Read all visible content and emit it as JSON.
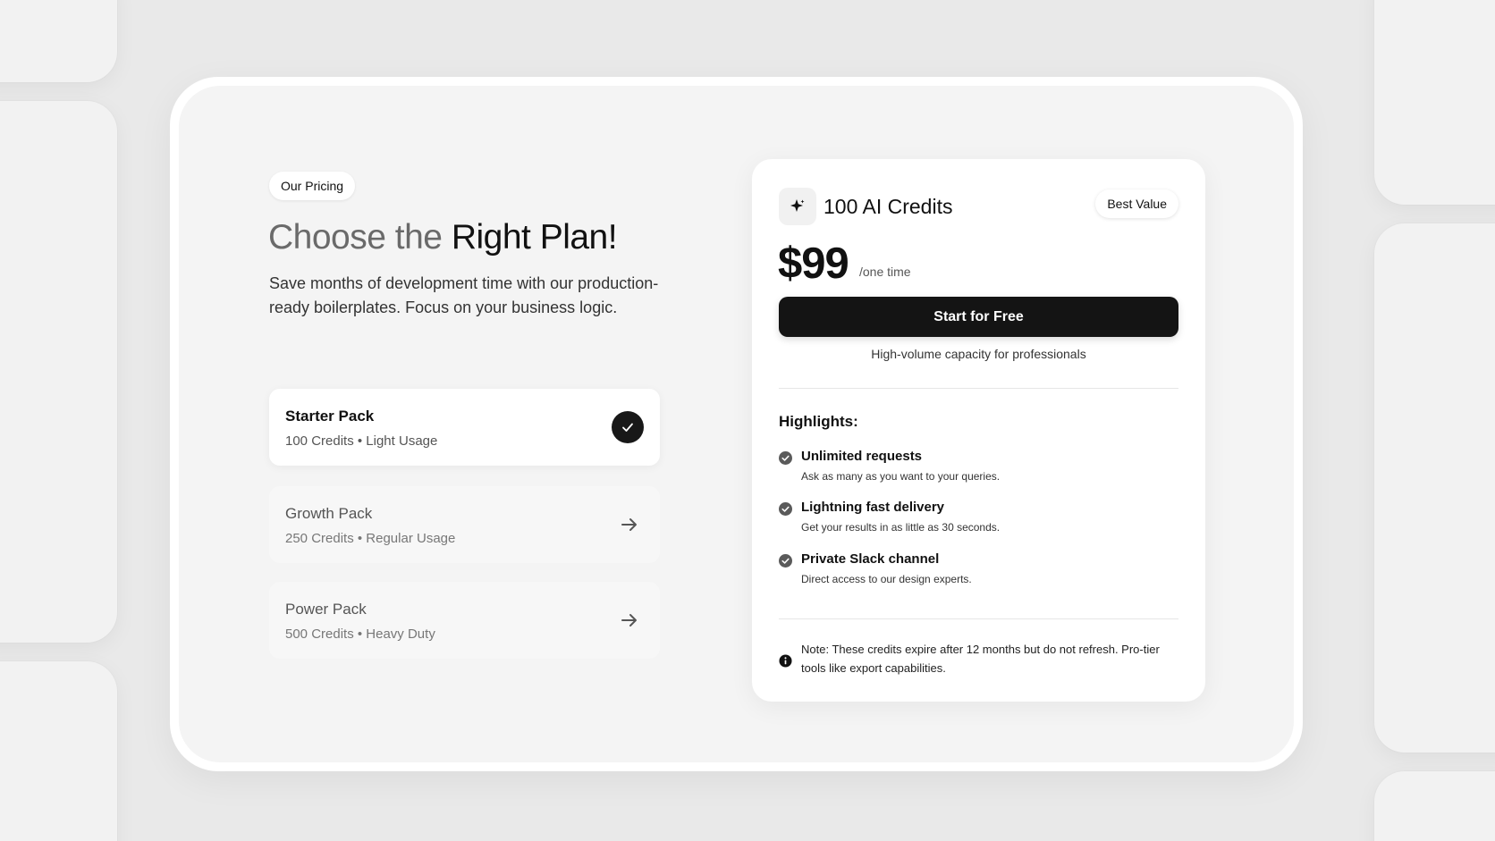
{
  "pricing_pill": "Our Pricing",
  "headline": {
    "muted": "Choose the ",
    "strong": "Right Plan!"
  },
  "subtitle": "Save months of development time with our production-ready boilerplates. Focus on your business logic.",
  "plans": [
    {
      "name": "Starter Pack",
      "detail": "100 Credits • Light Usage",
      "selected": true,
      "icon": "check-icon"
    },
    {
      "name": "Growth Pack",
      "detail": "250 Credits • Regular Usage",
      "selected": false,
      "icon": "arrow-right-icon"
    },
    {
      "name": "Power Pack",
      "detail": "500 Credits • Heavy Duty",
      "selected": false,
      "icon": "arrow-right-icon"
    }
  ],
  "card": {
    "icon": "sparkle-icon",
    "title": "100 AI Credits",
    "badge": "Best Value",
    "price": "$99",
    "price_suffix": "/one time",
    "cta_label": "Start for Free",
    "cta_caption": "High-volume capacity for professionals",
    "highlights_title": "Highlights:",
    "features": [
      {
        "title": "Unlimited requests",
        "desc": "Ask as many as you want to your queries."
      },
      {
        "title": "Lightning fast delivery",
        "desc": "Get your results in as little as 30 seconds."
      },
      {
        "title": "Private Slack channel",
        "desc": "Direct access to our design experts."
      }
    ],
    "note_icon": "info-icon",
    "note": "Note: These credits expire after 12 months but do not refresh. Pro-tier tools like export capabilities."
  },
  "colors": {
    "page_bg": "#e9e9e9",
    "frame_bg": "#f4f4f4",
    "accent_dark": "#141414",
    "muted_text": "#6a6a6a"
  }
}
